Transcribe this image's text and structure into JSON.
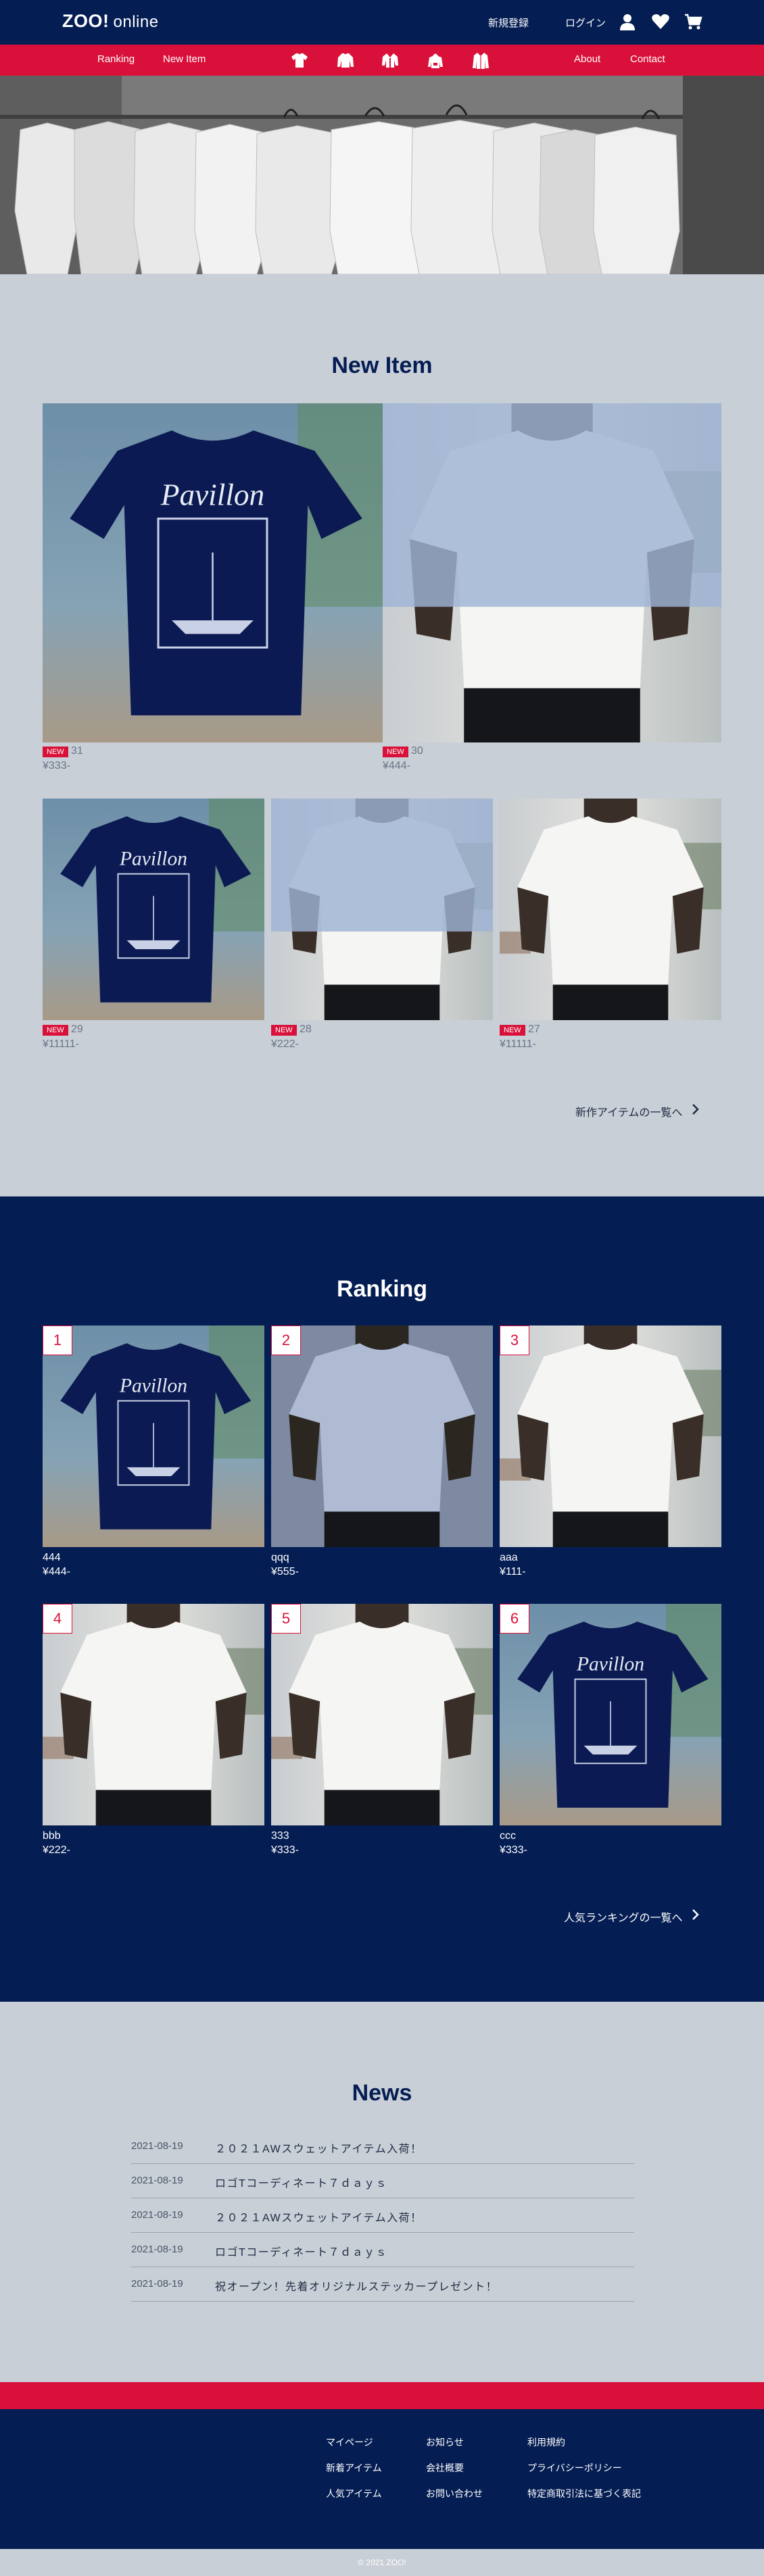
{
  "header": {
    "logo_main": "ZOO!",
    "logo_sub": "online",
    "register": "新規登録",
    "login": "ログイン",
    "icons": [
      "user-icon",
      "heart-icon",
      "cart-icon"
    ]
  },
  "nav": {
    "ranking": "Ranking",
    "new_item": "New Item",
    "about": "About",
    "contact": "Contact",
    "category_icons": [
      "tshirt-icon",
      "longsleeve-icon",
      "jacket-icon",
      "hoodie-icon",
      "coat-icon"
    ]
  },
  "new_item": {
    "title": "New Item",
    "tag": "NEW",
    "products": [
      {
        "num": "31",
        "price": "¥333-"
      },
      {
        "num": "30",
        "price": "¥444-"
      },
      {
        "num": "29",
        "price": "¥11111-"
      },
      {
        "num": "28",
        "price": "¥222-"
      },
      {
        "num": "27",
        "price": "¥11111-"
      }
    ],
    "more": "新作アイテムの一覧へ"
  },
  "ranking": {
    "title": "Ranking",
    "items": [
      {
        "rank": "1",
        "name": "444",
        "price": "¥444-"
      },
      {
        "rank": "2",
        "name": "qqq",
        "price": "¥555-"
      },
      {
        "rank": "3",
        "name": "aaa",
        "price": "¥111-"
      },
      {
        "rank": "4",
        "name": "bbb",
        "price": "¥222-"
      },
      {
        "rank": "5",
        "name": "333",
        "price": "¥333-"
      },
      {
        "rank": "6",
        "name": "ccc",
        "price": "¥333-"
      }
    ],
    "more": "人気ランキングの一覧へ"
  },
  "news": {
    "title": "News",
    "items": [
      {
        "date": "2021-08-19",
        "text": "２０２１AWスウェットアイテム入荷！"
      },
      {
        "date": "2021-08-19",
        "text": "ロゴTコーディネート７ｄａｙｓ"
      },
      {
        "date": "2021-08-19",
        "text": "２０２１AWスウェットアイテム入荷！"
      },
      {
        "date": "2021-08-19",
        "text": "ロゴTコーディネート７ｄａｙｓ"
      },
      {
        "date": "2021-08-19",
        "text": "祝オープン！先着オリジナルステッカープレゼント！"
      }
    ]
  },
  "footer": {
    "col1": [
      "マイページ",
      "新着アイテム",
      "人気アイテム"
    ],
    "col2": [
      "お知らせ",
      "会社概要",
      "お問い合わせ"
    ],
    "col3": [
      "利用規約",
      "プライバシーポリシー",
      "特定商取引法に基づく表記"
    ],
    "copyright": "© 2021 ZOO!"
  },
  "colors": {
    "navy": "#041d53",
    "red": "#d9113a",
    "background": "#c9cfd6"
  }
}
